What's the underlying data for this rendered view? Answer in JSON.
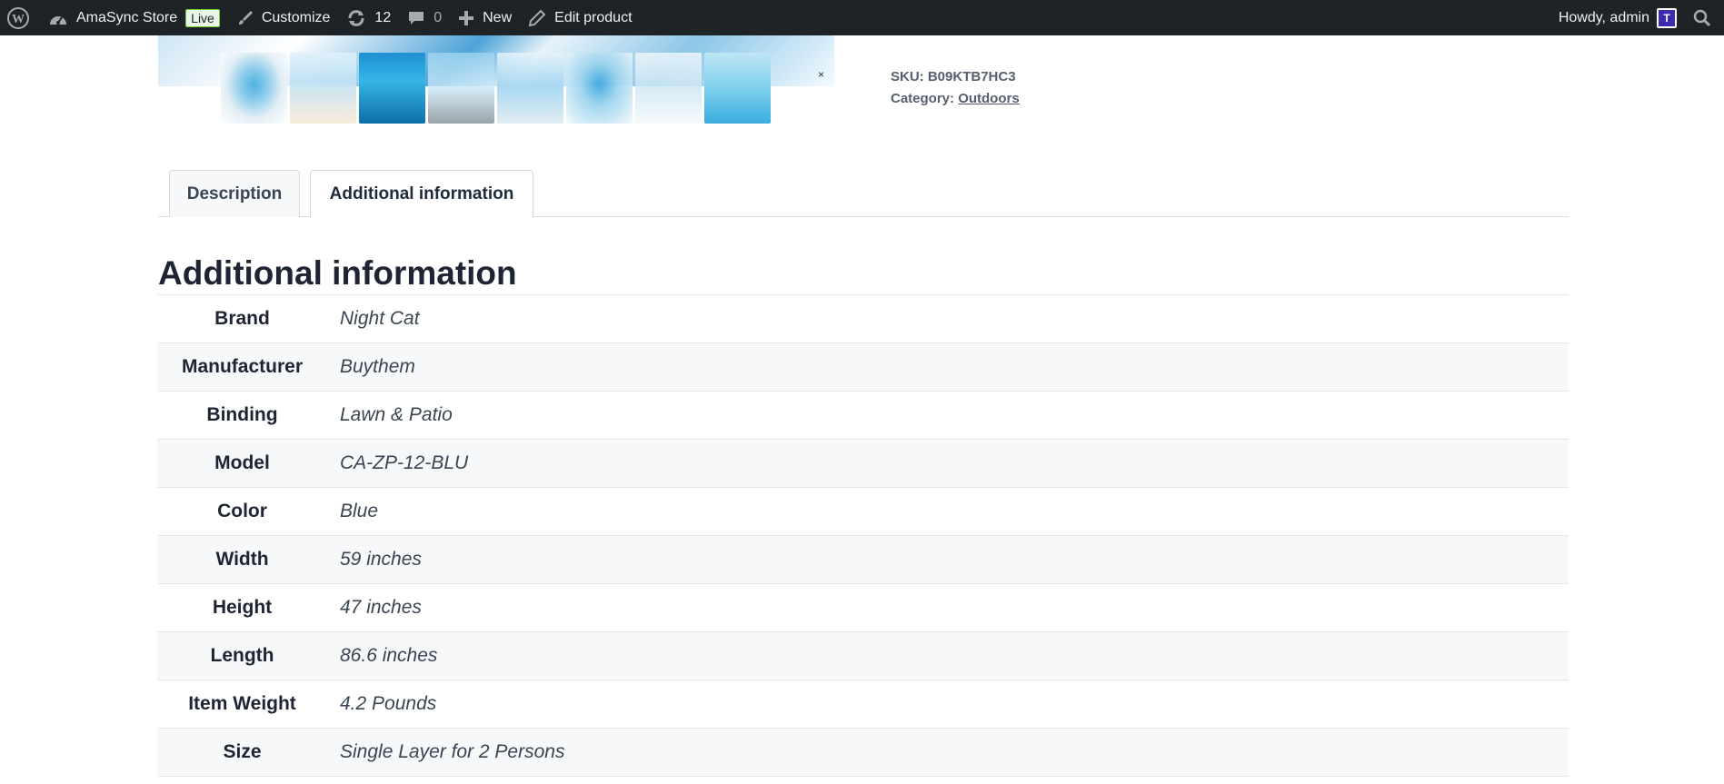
{
  "adminbar": {
    "site_name": "AmaSync Store",
    "live_badge": "Live",
    "customize": "Customize",
    "updates_count": "12",
    "comments_count": "0",
    "new_label": "New",
    "edit_product": "Edit product",
    "greeting": "Howdy, admin",
    "avatar_letter": "T"
  },
  "product_meta": {
    "sku_label": "SKU:",
    "sku_value": "B09KTB7HC3",
    "category_label": "Category:",
    "category_value": "Outdoors"
  },
  "gallery": {
    "close_glyph": "×",
    "thumbnail_count": 8
  },
  "tabs": [
    {
      "label": "Description",
      "active": false
    },
    {
      "label": "Additional information",
      "active": true
    }
  ],
  "section_title": "Additional information",
  "attributes": [
    {
      "name": "Brand",
      "value": "Night Cat"
    },
    {
      "name": "Manufacturer",
      "value": "Buythem"
    },
    {
      "name": "Binding",
      "value": "Lawn & Patio"
    },
    {
      "name": "Model",
      "value": "CA-ZP-12-BLU"
    },
    {
      "name": "Color",
      "value": "Blue"
    },
    {
      "name": "Width",
      "value": "59 inches"
    },
    {
      "name": "Height",
      "value": "47 inches"
    },
    {
      "name": "Length",
      "value": "86.6 inches"
    },
    {
      "name": "Item Weight",
      "value": "4.2 Pounds"
    },
    {
      "name": "Size",
      "value": "Single Layer for 2 Persons"
    }
  ],
  "colors": {
    "adminbar_bg": "#1d2327",
    "row_alt_bg": "#f6f8fa",
    "avatar_bg": "#3b2bb0"
  }
}
